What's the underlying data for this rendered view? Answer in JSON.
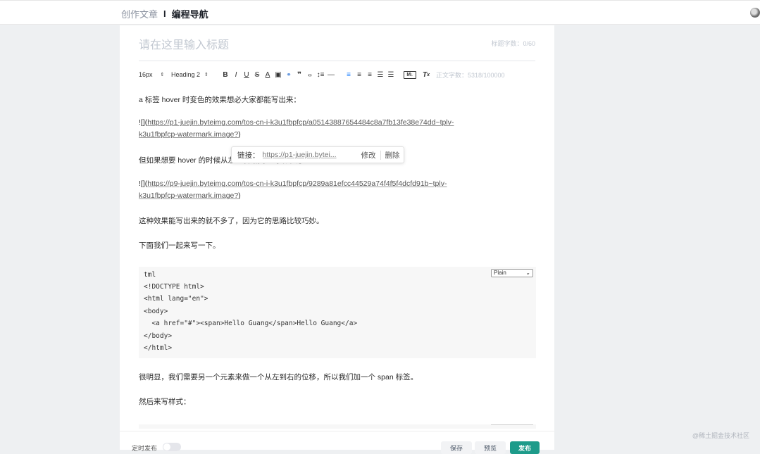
{
  "header": {
    "crumb_parent": "创作文章",
    "crumb_sep": "I",
    "crumb_current": "编程导航"
  },
  "editor": {
    "title_placeholder": "请在这里输入标题",
    "title_count": "标题字数：0/60",
    "word_count": "正文字数：5318/100000"
  },
  "toolbar": {
    "font_size": "16px",
    "heading": "Heading 2",
    "icons": [
      "bold-icon",
      "italic-icon",
      "underline-icon",
      "strikethrough-icon",
      "font-color-icon",
      "image-icon",
      "link-icon",
      "quote-icon",
      "code-icon",
      "line-height-icon",
      "divider-icon",
      "align-left-icon",
      "align-center-icon",
      "align-right-icon",
      "ordered-list-icon",
      "bullet-list-icon",
      "markdown-icon",
      "clear-format-icon"
    ],
    "glyphs": {
      "bold": "B",
      "italic": "I",
      "underline": "U",
      "strike": "S",
      "color": "A",
      "image": "▣",
      "link": "🔗",
      "quote": "❞",
      "code": "‹›",
      "lineheight": "↕",
      "divider": "—",
      "alignl": "≡",
      "alignc": "≡",
      "alignr": "≡",
      "olist": "☰",
      "ulist": "☰",
      "md": "M↓",
      "clear": "T̸"
    }
  },
  "content": {
    "p1": "a 标签 hover 时变色的效果想必大家都能写出来：",
    "img1_prefix": "![](",
    "img1_url_a": "https://p1-juejin.byteimg.com/tos-cn-i-k3u1fbpfcp/a05143887654484c8a7fb13fe38e74dd~tplv-",
    "img1_url_b": "k3u1fbpfcp-watermark.image?",
    "img1_suffix": ")",
    "p2": "但如果想要 hover 的时候从左到右渐变色的效果呢",
    "img2_prefix": "![](",
    "img2_url_a": "https://p9-juejin.byteimg.com/tos-cn-i-k3u1fbpfcp/9289a81efcc44529a74f4f5f4dcfd91b~tplv-",
    "img2_url_b": "k3u1fbpfcp-watermark.image?",
    "img2_suffix": ")",
    "p3": "这种效果能写出来的就不多了，因为它的思路比较巧妙。",
    "p4": "下面我们一起来写一下。",
    "p5": "很明显，我们需要另一个元素来做一个从左到右的位移，所以我们加一个 span 标签。",
    "p6": "然后来写样式："
  },
  "link_popup": {
    "label": "链接：",
    "url": "https://p1-juejin.bytei...",
    "edit": "修改",
    "delete": "删除"
  },
  "code_block": {
    "language": "Plain",
    "lines": [
      "tml",
      "<!DOCTYPE html>",
      "<html lang=\"en\">",
      "<body>",
      "  <a href=\"#\"><span>Hello Guang</span>Hello Guang</a>",
      "</body>",
      "</html>"
    ]
  },
  "footer": {
    "schedule": "定时发布",
    "save": "保存",
    "preview": "预览",
    "publish": "发布",
    "watermark": "@稀土掘金技术社区"
  }
}
